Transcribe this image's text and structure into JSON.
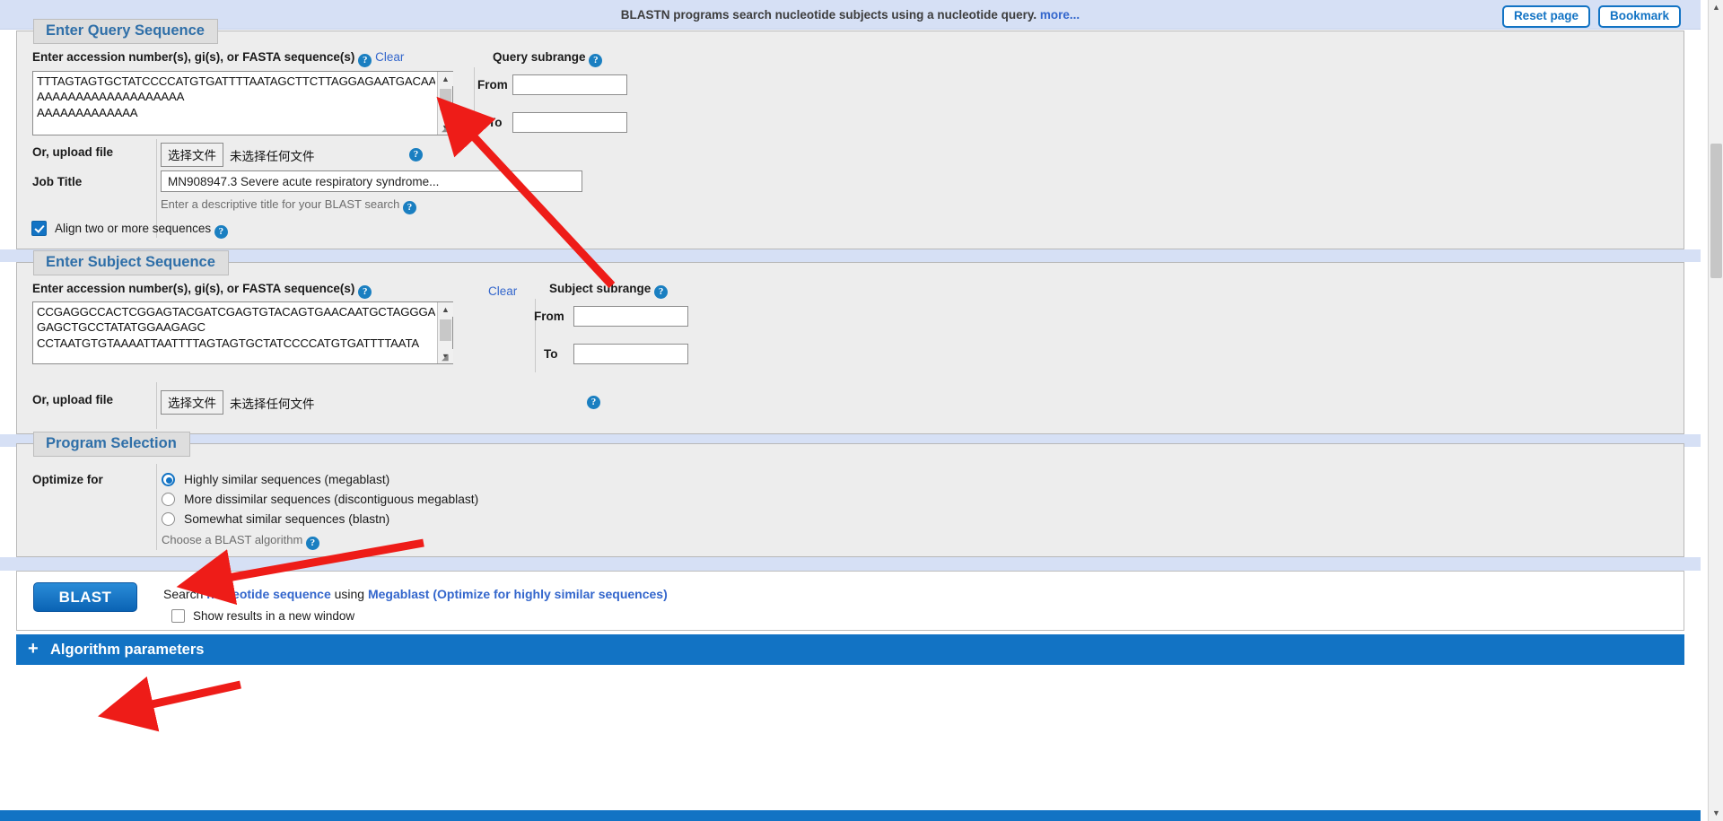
{
  "header": {
    "blurb": "BLASTN programs search nucleotide subjects using a nucleotide query.",
    "more_link": "more...",
    "reset_label": "Reset page",
    "bookmark_label": "Bookmark"
  },
  "query_section": {
    "legend": "Enter Query Sequence",
    "enter_label_prefix": "Enter accession number(s), gi(s), or ",
    "enter_label_bold": "FASTA",
    "enter_label_suffix": " sequence(s)",
    "clear_label": "Clear",
    "sequence_value": "TTTAGTAGTGCTATCCCCATGTGATTTTAATAGCTTCTTAGGAGAATGACAA\nAAAAAAAAAAAAAAAAAAA\nAAAAAAAAAAAAA",
    "subrange_label": "Query subrange",
    "from_label": "From",
    "to_label": "To",
    "from_value": "",
    "to_value": "",
    "upload_label": "Or, upload file",
    "file_button": "选择文件",
    "file_status": "未选择任何文件",
    "job_title_label": "Job Title",
    "job_title_value": "MN908947.3 Severe acute respiratory syndrome...",
    "job_title_hint": "Enter a descriptive title for your BLAST search",
    "align_checkbox_label": "Align two or more sequences",
    "align_checked": true
  },
  "subject_section": {
    "legend": "Enter Subject Sequence",
    "enter_label_prefix": "Enter accession number(s), gi(s), or ",
    "enter_label_bold": "FASTA",
    "enter_label_suffix": " sequence(s)",
    "clear_label": "Clear",
    "sequence_value": "CCGAGGCCACTCGGAGTACGATCGAGTGTACAGTGAACAATGCTAGGGA\nGAGCTGCCTATATGGAAGAGC\nCCTAATGTGTAAAATTAATTTTAGTAGTGCTATCCCCATGTGATTTTAATA",
    "subrange_label": "Subject subrange",
    "from_label": "From",
    "to_label": "To",
    "from_value": "",
    "to_value": "",
    "upload_label": "Or, upload file",
    "file_button": "选择文件",
    "file_status": "未选择任何文件"
  },
  "program_section": {
    "legend": "Program Selection",
    "optimize_label": "Optimize for",
    "options": [
      {
        "label": "Highly similar sequences (megablast)",
        "selected": true
      },
      {
        "label": "More dissimilar sequences (discontiguous megablast)",
        "selected": false
      },
      {
        "label": "Somewhat similar sequences (blastn)",
        "selected": false
      }
    ],
    "choose_hint": "Choose a BLAST algorithm"
  },
  "submit_section": {
    "blast_label": "BLAST",
    "search_prefix": "Search ",
    "search_db": "nucleotide sequence",
    "search_using": " using ",
    "search_program": "Megablast (Optimize for highly similar sequences)",
    "new_window_label": "Show results in a new window",
    "new_window_checked": false
  },
  "algorithm_bar": {
    "plus": "+",
    "label": "Algorithm parameters"
  },
  "icons": {
    "help": "?",
    "scroll_up": "▲",
    "scroll_down": "▼",
    "resize_grip": "◢"
  },
  "colors": {
    "accent_blue": "#1273c4",
    "banner_blue": "#d6e0f5",
    "panel_gray": "#ededed",
    "link_blue": "#3366cc",
    "arrow_red": "#ee1c18"
  }
}
